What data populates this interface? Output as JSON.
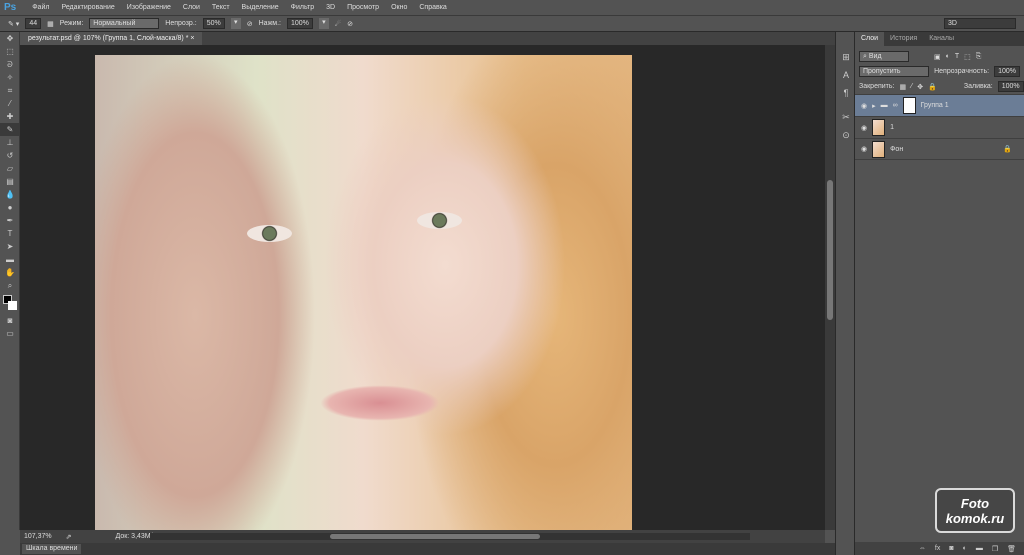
{
  "app": {
    "logo": "Ps",
    "menu": [
      "Файл",
      "Редактирование",
      "Изображение",
      "Слои",
      "Текст",
      "Выделение",
      "Фильтр",
      "3D",
      "Просмотр",
      "Окно",
      "Справка"
    ]
  },
  "options": {
    "brush_size": "44",
    "mode_label": "Режим:",
    "mode_value": "Нормальный",
    "opacity_label": "Непрозр.:",
    "opacity_value": "50%",
    "pressure_label": "Нажм.:",
    "pressure_value": "100%",
    "workspace": "3D"
  },
  "document": {
    "tab_title": "результат.psd @ 107% (Группа 1, Слой-маска/8) *",
    "close": "×"
  },
  "status": {
    "zoom": "107,37%",
    "doc": "Док: 3,43M/9,39M",
    "timeline": "Шкала времени"
  },
  "layers_panel": {
    "tabs": [
      "Слои",
      "История",
      "Каналы"
    ],
    "filter": "Вид",
    "blend_mode": "Пропустить",
    "opacity_label": "Непрозрачность:",
    "opacity_value": "100%",
    "lock_label": "Закрепить:",
    "fill_label": "Заливка:",
    "fill_value": "100%",
    "layers": [
      {
        "name": "Группа 1",
        "selected": true,
        "type": "group"
      },
      {
        "name": "1",
        "selected": false,
        "type": "layer"
      },
      {
        "name": "Фон",
        "selected": false,
        "type": "background",
        "locked": true
      }
    ]
  },
  "watermark": "Foto komok.ru"
}
